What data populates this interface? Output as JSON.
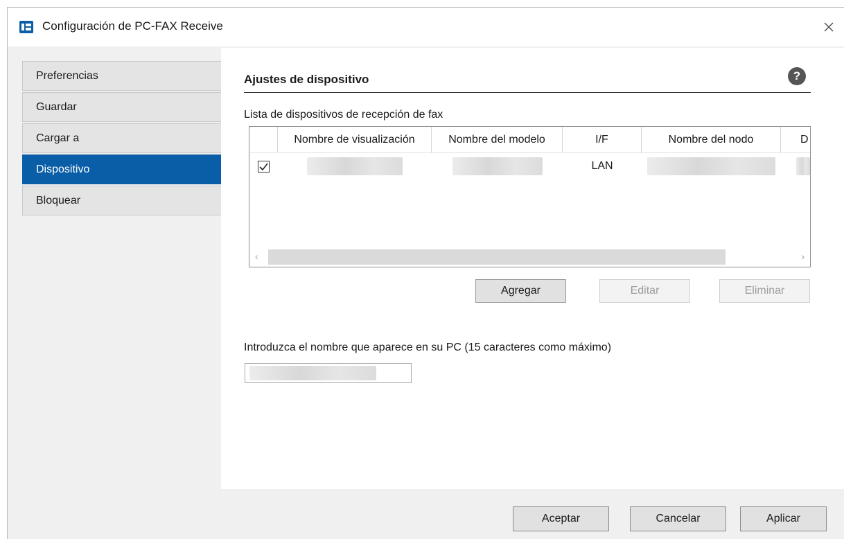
{
  "window": {
    "title": "Configuración de PC-FAX Receive",
    "icon": "fax-app-icon",
    "close_symbol": "✕"
  },
  "nav": {
    "items": [
      {
        "label": "Preferencias",
        "active": false
      },
      {
        "label": "Guardar",
        "active": false
      },
      {
        "label": "Cargar a",
        "active": false
      },
      {
        "label": "Dispositivo",
        "active": true
      },
      {
        "label": "Bloquear",
        "active": false
      }
    ]
  },
  "panel": {
    "title": "Ajustes de dispositivo",
    "help_symbol": "?",
    "list_label": "Lista de dispositivos de recepción de fax",
    "columns": [
      "Nombre de visualización",
      "Nombre del modelo",
      "I/F",
      "Nombre del nodo",
      "D"
    ],
    "rows": [
      {
        "checked": true,
        "display_name": "",
        "model_name": "",
        "interface": "LAN",
        "node_name": "",
        "extra": ""
      }
    ],
    "buttons": {
      "add": "Agregar",
      "edit": "Editar",
      "delete": "Eliminar"
    },
    "pc_name_label": "Introduzca el nombre que aparece en su PC (15 caracteres como máximo)",
    "pc_name_value": ""
  },
  "footer": {
    "ok": "Aceptar",
    "cancel": "Cancelar",
    "apply": "Aplicar"
  },
  "colors": {
    "accent": "#0a5ea8",
    "window_bg": "#f0f0f0",
    "panel_bg": "#ffffff"
  }
}
